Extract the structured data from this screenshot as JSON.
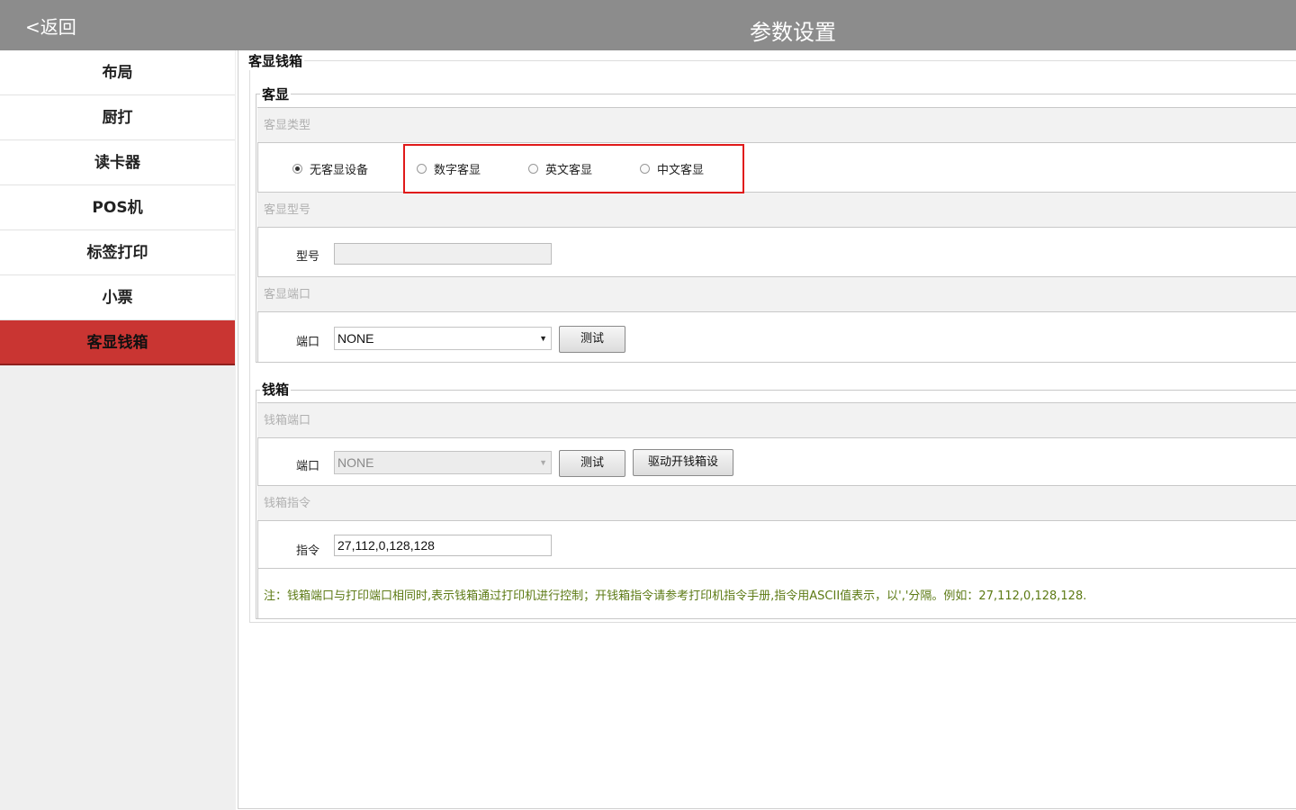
{
  "header": {
    "back_label": "<返回",
    "title": "参数设置"
  },
  "sidebar": {
    "items": [
      {
        "label": "布局"
      },
      {
        "label": "厨打"
      },
      {
        "label": "读卡器"
      },
      {
        "label": "POS机"
      },
      {
        "label": "标签打印"
      },
      {
        "label": "小票"
      },
      {
        "label": "客显钱箱",
        "active": true
      }
    ]
  },
  "page": {
    "fieldset_title": "客显钱箱",
    "display": {
      "group_title": "客显",
      "type_header": "客显类型",
      "type_options": [
        {
          "label": "无客显设备",
          "selected": true
        },
        {
          "label": "数字客显",
          "selected": false
        },
        {
          "label": "英文客显",
          "selected": false
        },
        {
          "label": "中文客显",
          "selected": false
        }
      ],
      "model_header": "客显型号",
      "model_label": "型号",
      "model_value": "",
      "port_header": "客显端口",
      "port_label": "端口",
      "port_value": "NONE",
      "test_button": "测试"
    },
    "cashbox": {
      "group_title": "钱箱",
      "port_header": "钱箱端口",
      "port_label": "端口",
      "port_value": "NONE",
      "test_button": "测试",
      "driver_button": "驱动开钱箱设",
      "command_header": "钱箱指令",
      "command_label": "指令",
      "command_value": "27,112,0,128,128",
      "note": "注：钱箱端口与打印端口相同时,表示钱箱通过打印机进行控制；开钱箱指令请参考打印机指令手册,指令用ASCII值表示，以','分隔。例如：27,112,0,128,128."
    }
  },
  "colors": {
    "header_bg": "#8c8c8c",
    "active_nav": "#c93532",
    "highlight_border": "#e01a1a",
    "note_text": "#5c7a14"
  }
}
